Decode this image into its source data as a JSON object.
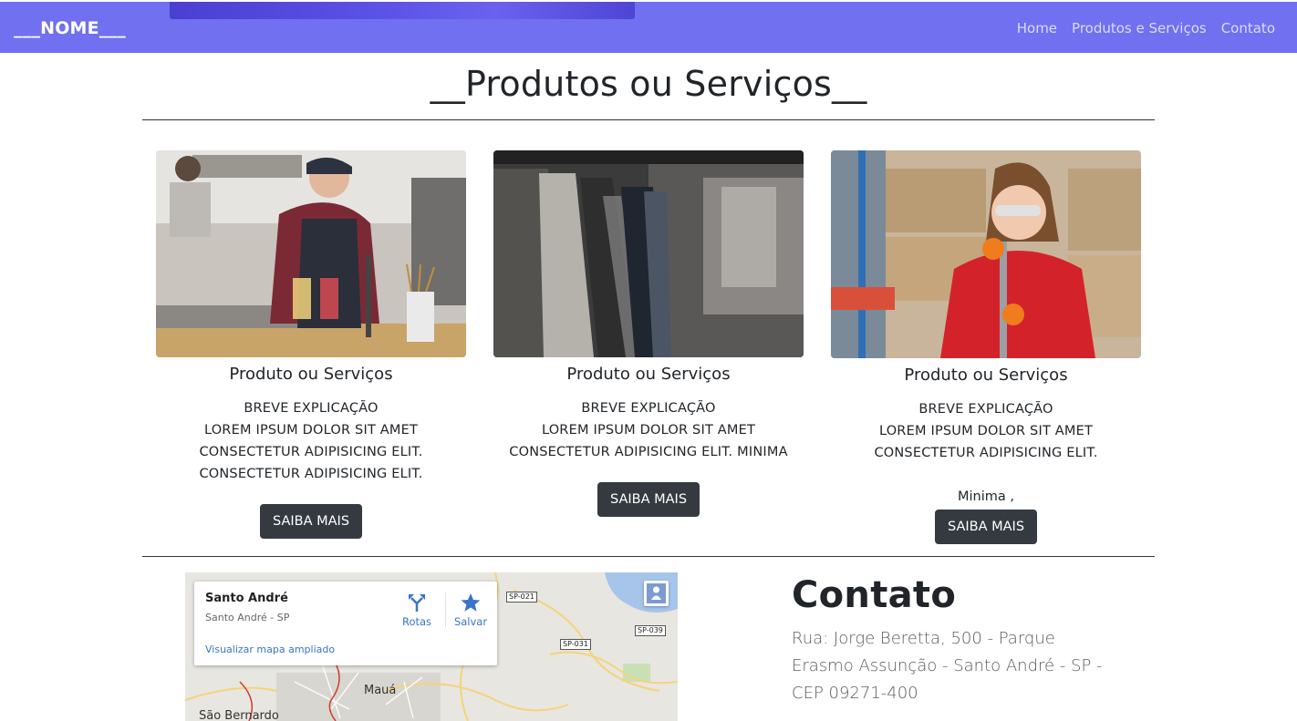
{
  "navbar": {
    "brand": "___NOME___",
    "links": [
      "Home",
      "Produtos e Serviços",
      "Contato"
    ],
    "background": "#7070f0"
  },
  "section": {
    "title": "__Produtos ou Serviços__"
  },
  "cards": [
    {
      "title": "Produto ou Serviços",
      "lines": [
        "BREVE EXPLICAÇÃO",
        "LOREM IPSUM DOLOR SIT AMET",
        "CONSECTETUR ADIPISICING ELIT.",
        "CONSECTETUR ADIPISICING ELIT."
      ],
      "note": "",
      "button": "SAIBA MAIS"
    },
    {
      "title": "Produto ou Serviços",
      "lines": [
        "BREVE EXPLICAÇÃO",
        "LOREM IPSUM DOLOR SIT AMET",
        "CONSECTETUR ADIPISICING ELIT. MINIMA"
      ],
      "note": "",
      "button": "SAIBA MAIS"
    },
    {
      "title": "Produto ou Serviços",
      "lines": [
        "BREVE EXPLICAÇÃO",
        "LOREM IPSUM DOLOR SIT AMET",
        "CONSECTETUR ADIPISICING ELIT."
      ],
      "note": "Minima ,",
      "button": "SAIBA MAIS"
    }
  ],
  "map": {
    "place": "Santo André",
    "subtitle": "Santo André - SP",
    "directions": "Rotas",
    "save": "Salvar",
    "view_larger": "Visualizar mapa ampliado",
    "labels": [
      "Mauá",
      "São Bernardo"
    ],
    "shields": [
      "SP-021",
      "SP-039",
      "SP-031"
    ]
  },
  "contact": {
    "title": "Contato",
    "address": "Rua: Jorge Beretta, 500 - Parque Erasmo Assunção - Santo André - SP - CEP 09271-400"
  }
}
